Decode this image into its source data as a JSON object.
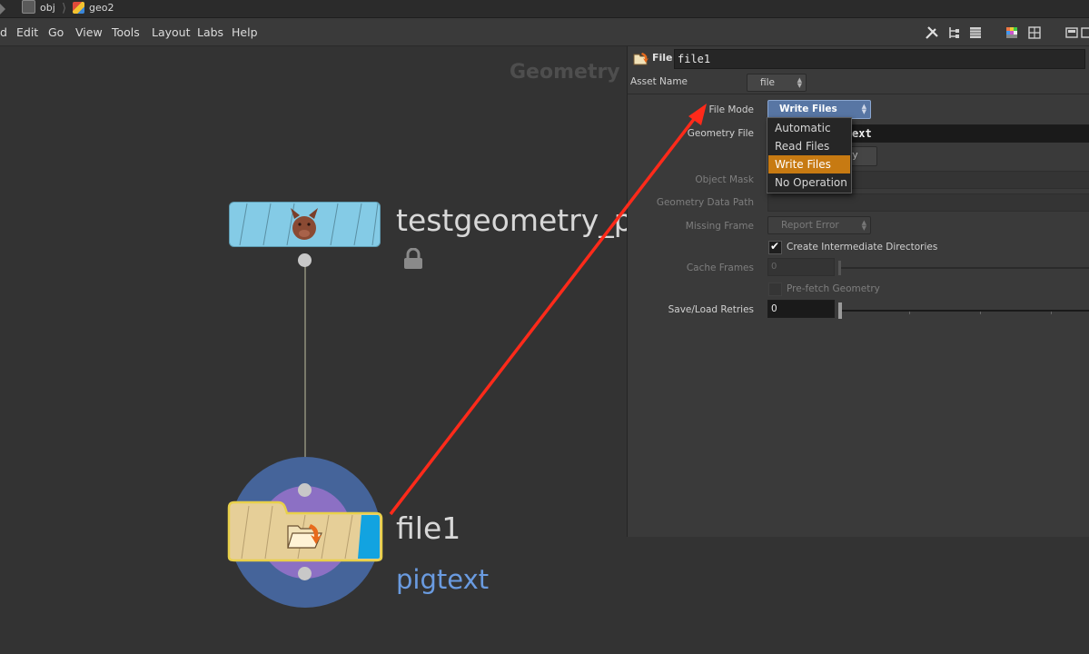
{
  "path": {
    "crumbs": [
      {
        "label": "obj",
        "icon": "obj-network-icon"
      },
      {
        "label": "geo2",
        "icon": "geometry-object-icon"
      }
    ]
  },
  "menubar": {
    "partial_first": "d",
    "items": [
      "Edit",
      "Go",
      "View",
      "Tools",
      "Layout",
      "Labs",
      "Help"
    ]
  },
  "network": {
    "context_label": "Geometry",
    "nodes": [
      {
        "name": "testgeometry_pi",
        "icon": "pig-head-icon",
        "color": "#84cbe6",
        "locked": true
      },
      {
        "name": "file1",
        "subtitle": "pigtext",
        "icon": "folder-open-icon",
        "color": "#e6cf98",
        "selected": true
      }
    ]
  },
  "params": {
    "node_type": "File",
    "node_name": "file1",
    "asset_name_label": "Asset Name",
    "asset_name_value": "file",
    "file_mode": {
      "label": "File Mode",
      "value": "Write Files"
    },
    "geometry_file": {
      "label": "Geometry File",
      "value_visible_tail": "ext"
    },
    "button_partial": "ry",
    "object_mask_label": "Object Mask",
    "geometry_data_path_label": "Geometry Data Path",
    "missing_frame": {
      "label": "Missing Frame",
      "value": "Report Error"
    },
    "create_intermediate": {
      "label": "Create Intermediate Directories",
      "checked": true
    },
    "cache_frames": {
      "label": "Cache Frames",
      "value": "0"
    },
    "prefetch": {
      "label": "Pre-fetch Geometry",
      "checked": false
    },
    "save_load_retries": {
      "label": "Save/Load Retries",
      "value": "0"
    }
  },
  "dropdown": {
    "options": [
      "Automatic",
      "Read Files",
      "Write Files",
      "No Operation"
    ],
    "selected": "Write Files"
  },
  "colors": {
    "accent_orange": "#c77a12",
    "annotation_red": "#ff2a1a",
    "subtitle_blue": "#6a9be0"
  }
}
